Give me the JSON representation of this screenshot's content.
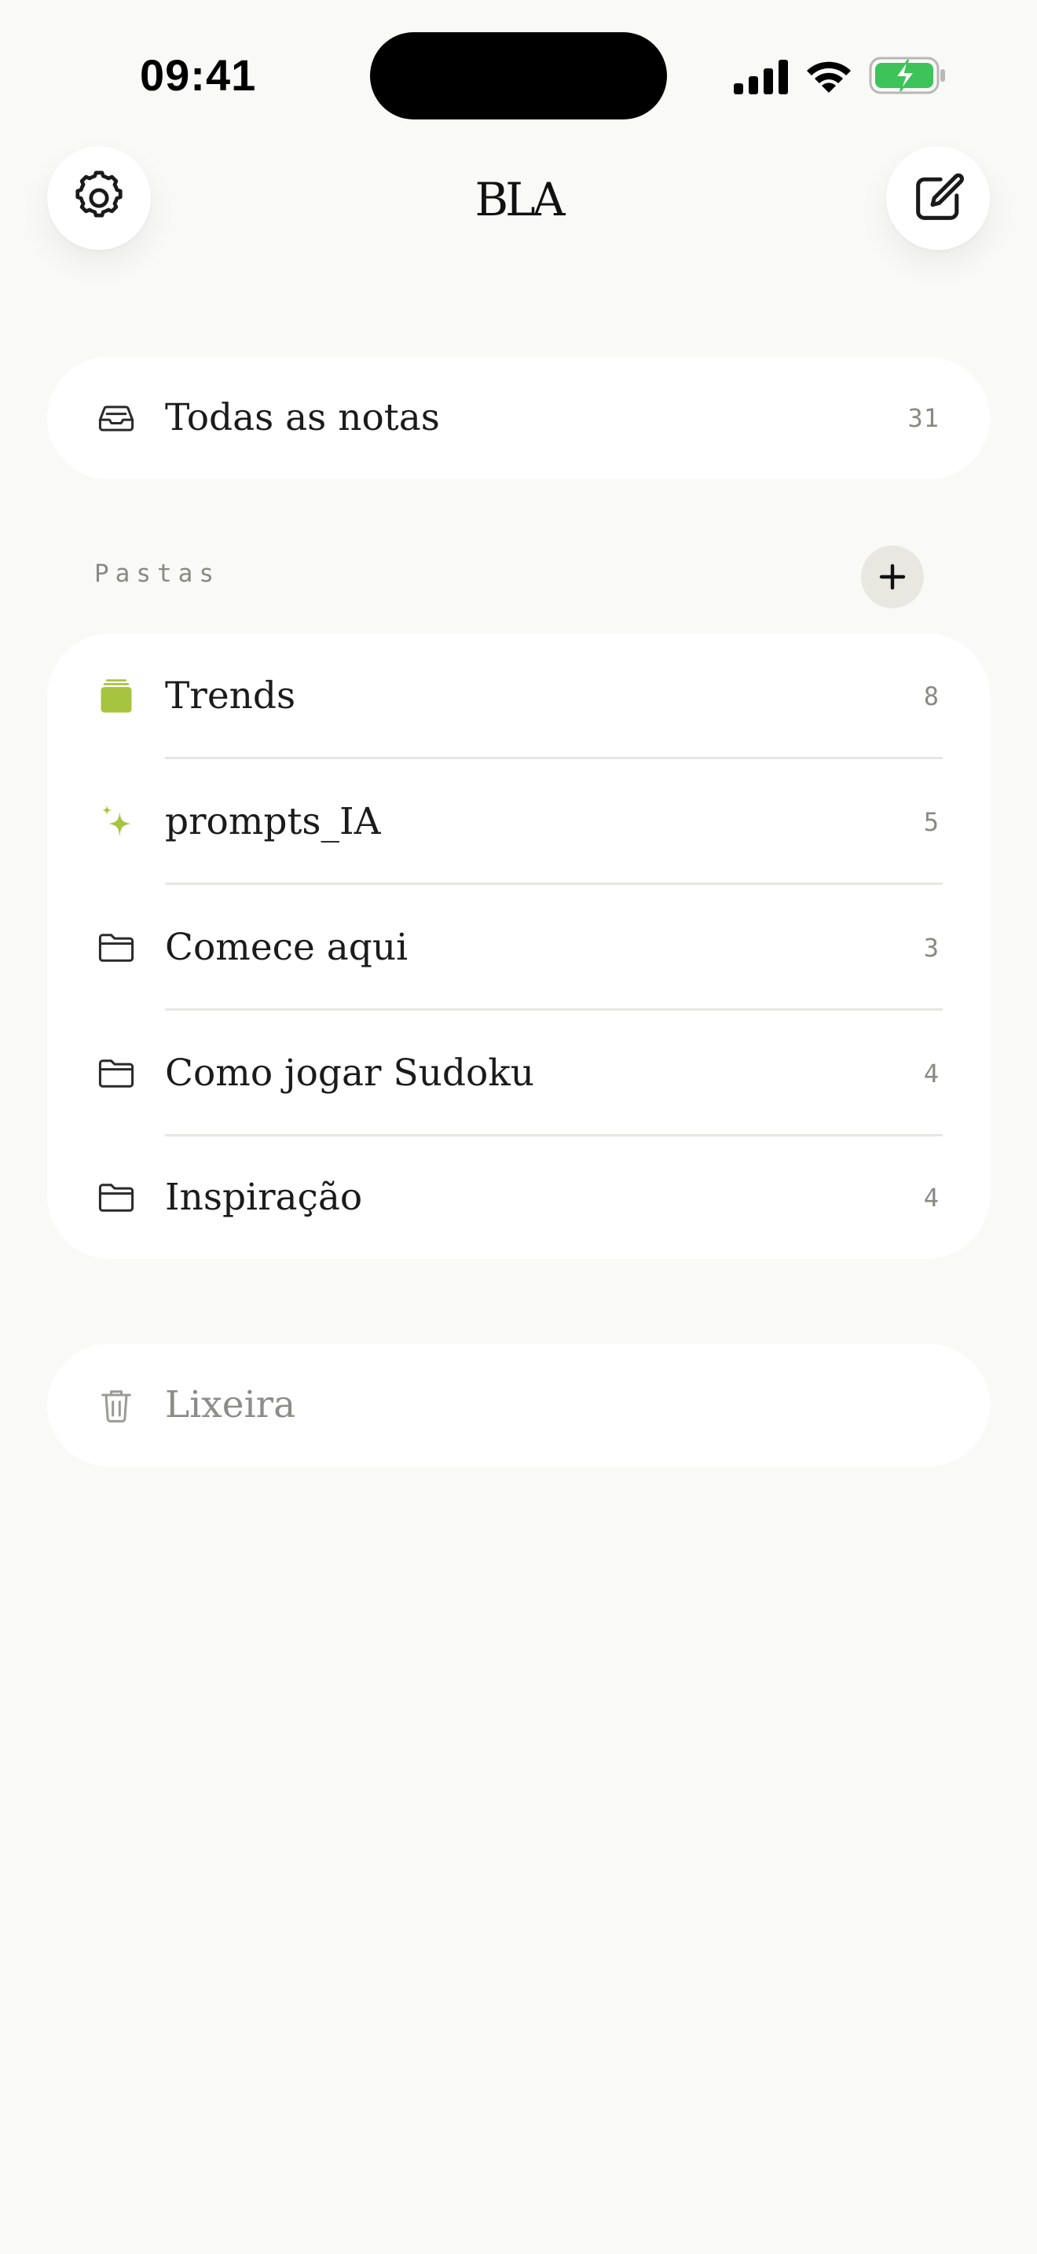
{
  "status_bar": {
    "time": "09:41"
  },
  "header": {
    "logo_text": "BLA",
    "settings_icon": "gear-icon",
    "compose_icon": "compose-icon"
  },
  "all_notes": {
    "label": "Todas as notas",
    "count": "31",
    "icon": "inbox-icon"
  },
  "folders_section": {
    "title": "Pastas",
    "add_icon": "plus-icon",
    "items": [
      {
        "label": "Trends",
        "count": "8",
        "icon": "stack-icon"
      },
      {
        "label": "prompts_IA",
        "count": "5",
        "icon": "sparkle-icon"
      },
      {
        "label": "Comece aqui",
        "count": "3",
        "icon": "folder-icon"
      },
      {
        "label": "Como jogar Sudoku",
        "count": "4",
        "icon": "folder-icon"
      },
      {
        "label": "Inspiração",
        "count": "4",
        "icon": "folder-icon"
      }
    ]
  },
  "trash": {
    "label": "Lixeira",
    "icon": "trash-icon"
  },
  "colors": {
    "background": "#f9f9f7",
    "card": "#ffffff",
    "accent_green": "#a6c43f",
    "battery_green": "#3dc35a",
    "muted_text": "#8a8a84"
  }
}
